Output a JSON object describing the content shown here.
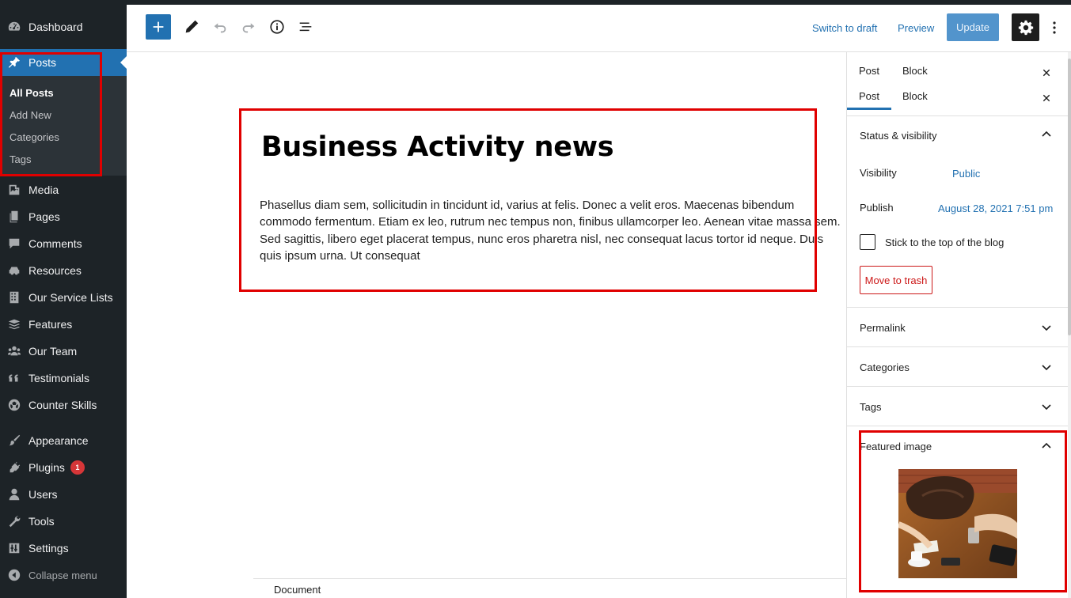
{
  "sidebar": {
    "items": [
      {
        "label": "Dashboard",
        "icon": "dashboard-icon"
      },
      {
        "label": "Posts",
        "icon": "pushpin-icon"
      },
      {
        "label": "Media",
        "icon": "media-icon"
      },
      {
        "label": "Pages",
        "icon": "pages-icon"
      },
      {
        "label": "Comments",
        "icon": "comments-icon"
      },
      {
        "label": "Resources",
        "icon": "car-icon"
      },
      {
        "label": "Our Service Lists",
        "icon": "building-icon"
      },
      {
        "label": "Features",
        "icon": "stack-icon"
      },
      {
        "label": "Our Team",
        "icon": "groups-icon"
      },
      {
        "label": "Testimonials",
        "icon": "quote-icon"
      },
      {
        "label": "Counter Skills",
        "icon": "sports-ball-icon"
      },
      {
        "label": "Appearance",
        "icon": "brush-icon"
      },
      {
        "label": "Plugins",
        "icon": "plugin-icon",
        "badge": "1"
      },
      {
        "label": "Users",
        "icon": "user-icon"
      },
      {
        "label": "Tools",
        "icon": "wrench-icon"
      },
      {
        "label": "Settings",
        "icon": "settings-sliders-icon"
      }
    ],
    "posts_submenu": [
      "All Posts",
      "Add New",
      "Categories",
      "Tags"
    ],
    "collapse_label": "Collapse menu"
  },
  "toolbar": {
    "switch_to_draft": "Switch to draft",
    "preview": "Preview",
    "update": "Update"
  },
  "post": {
    "title": "Business Activity news",
    "body": "Phasellus diam sem, sollicitudin in tincidunt id, varius at felis. Donec a velit eros. Maecenas bibendum commodo fermentum. Etiam ex leo, rutrum nec tempus non, finibus ullamcorper leo. Aenean vitae massa sem. Sed sagittis, libero eget placerat tempus, nunc eros pharetra nisl, nec consequat lacus tortor id neque. Duis quis ipsum urna. Ut consequat"
  },
  "footer": {
    "breadcrumb": "Document"
  },
  "settings": {
    "tabs": [
      "Post",
      "Block"
    ],
    "status_visibility": {
      "title": "Status & visibility",
      "visibility_label": "Visibility",
      "visibility_value": "Public",
      "publish_label": "Publish",
      "publish_value": "August 28, 2021 7:51 pm",
      "sticky_label": "Stick to the top of the blog",
      "trash_label": "Move to trash"
    },
    "panels": [
      "Permalink",
      "Categories",
      "Tags"
    ],
    "featured_image_title": "Featured image"
  },
  "colors": {
    "accent": "#2271b1",
    "admin_bg": "#1d2327",
    "annotation_red": "#e00000",
    "danger": "#cc1818"
  }
}
